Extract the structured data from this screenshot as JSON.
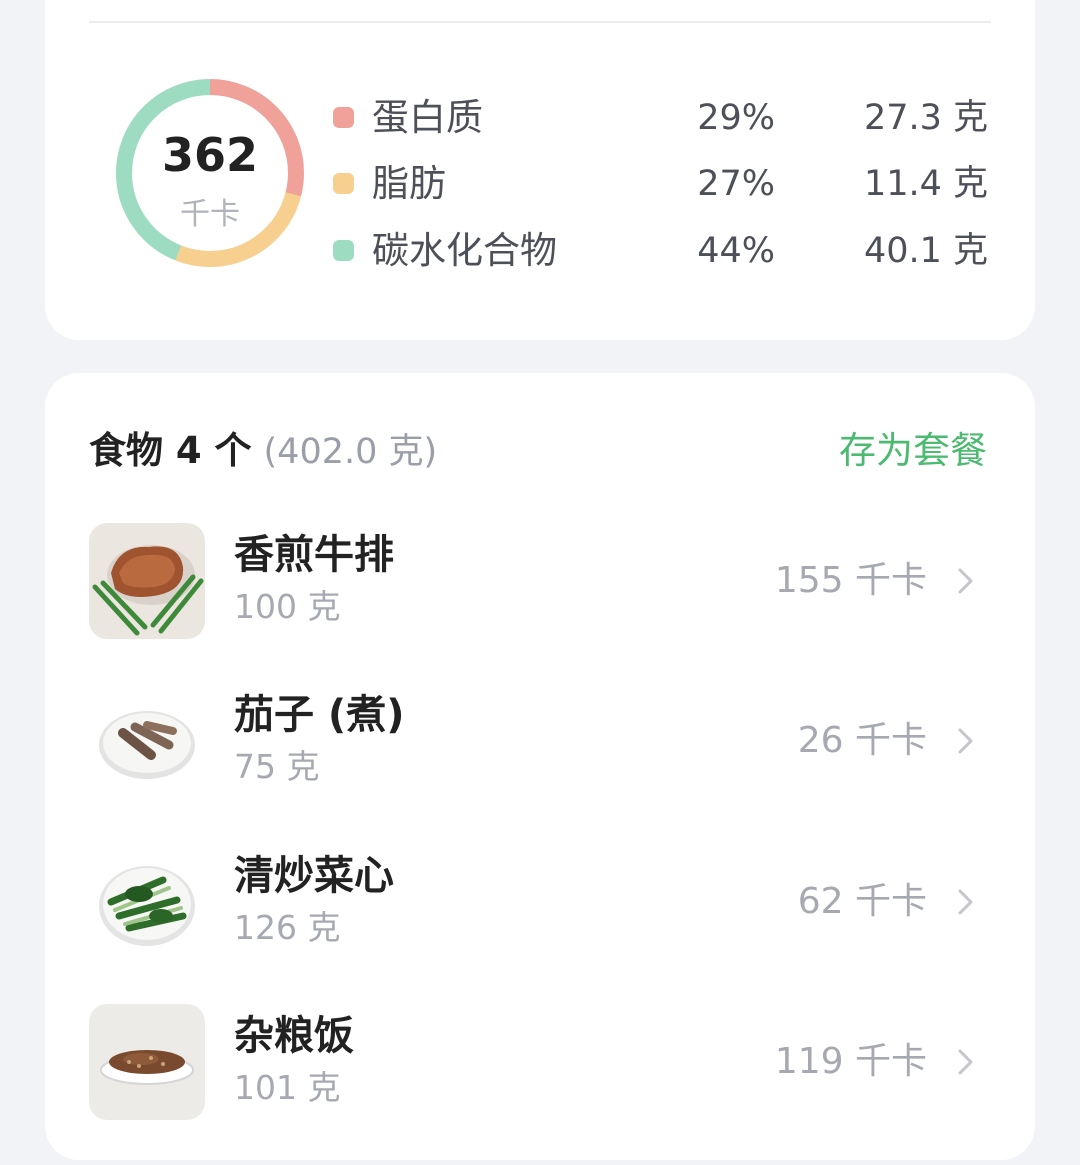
{
  "nutrition": {
    "calories": "362",
    "calories_unit": "千卡",
    "macros": [
      {
        "name": "蛋白质",
        "percent": "29%",
        "grams": "27.3 克",
        "color": "#f0a29a",
        "share": 0.29
      },
      {
        "name": "脂肪",
        "percent": "27%",
        "grams": "11.4 克",
        "color": "#f7cf8e",
        "share": 0.27
      },
      {
        "name": "碳水化合物",
        "percent": "44%",
        "grams": "40.1 克",
        "color": "#9ddcc0",
        "share": 0.44
      }
    ]
  },
  "foods": {
    "title": "食物 4 个",
    "total_weight": "(402.0 克)",
    "save_combo_label": "存为套餐",
    "items": [
      {
        "name": "香煎牛排",
        "weight": "100 克",
        "kcal": "155 千卡",
        "icon": "steak-image"
      },
      {
        "name": "茄子 (煮)",
        "weight": "75 克",
        "kcal": "26 千卡",
        "icon": "eggplant-image"
      },
      {
        "name": "清炒菜心",
        "weight": "126 克",
        "kcal": "62 千卡",
        "icon": "greens-image"
      },
      {
        "name": "杂粮饭",
        "weight": "101 克",
        "kcal": "119 千卡",
        "icon": "multigrain-rice-image"
      }
    ]
  }
}
